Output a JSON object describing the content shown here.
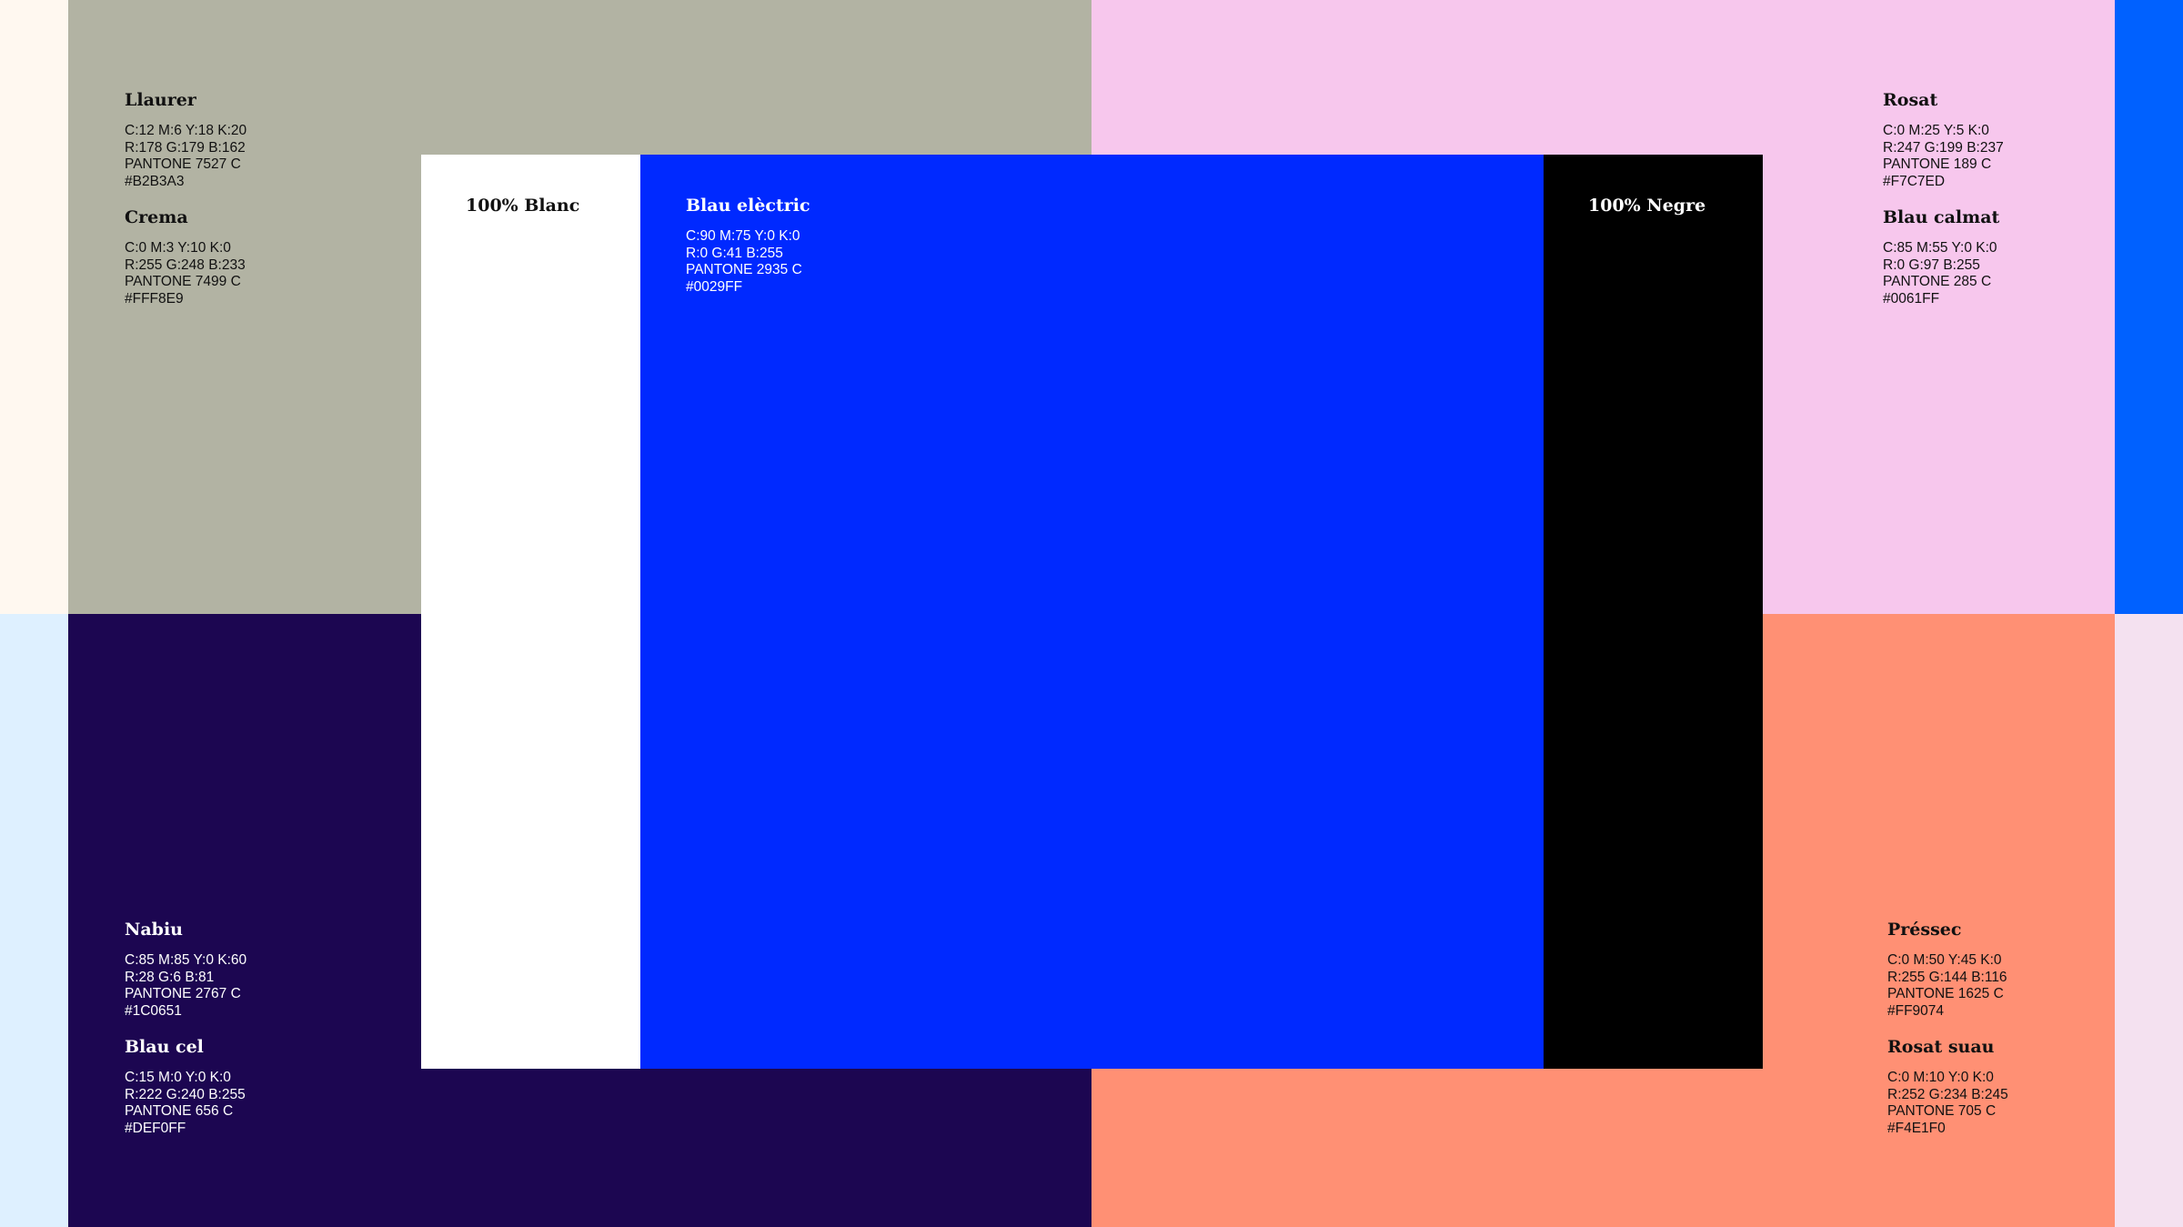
{
  "swatches": {
    "crema_edge": {
      "hex": "#FFF8E9"
    },
    "llaurer": {
      "name": "Llaurer",
      "cmyk": "C:12 M:6 Y:18 K:20",
      "rgb": "R:178 G:179 B:162",
      "pantone": "PANTONE 7527 C",
      "hex": "#B2B3A3"
    },
    "crema": {
      "name": "Crema",
      "cmyk": "C:0 M:3 Y:10 K:0",
      "rgb": "R:255 G:248 B:233",
      "pantone": "PANTONE 7499 C",
      "hex": "#FFF8E9"
    },
    "rosat": {
      "name": "Rosat",
      "cmyk": "C:0 M:25 Y:5 K:0",
      "rgb": "R:247 G:199 B:237",
      "pantone": "PANTONE 189 C",
      "hex": "#F7C7ED"
    },
    "blau_calmat": {
      "name": "Blau calmat",
      "cmyk": "C:85 M:55 Y:0 K:0",
      "rgb": "R:0 G:97 B:255",
      "pantone": "PANTONE 285 C",
      "hex": "#0061FF"
    },
    "nabiu": {
      "name": "Nabiu",
      "cmyk": "C:85 M:85 Y:0 K:60",
      "rgb": "R:28 G:6 B:81",
      "pantone": "PANTONE 2767 C",
      "hex": "#1C0651"
    },
    "blau_cel": {
      "name": "Blau cel",
      "cmyk": "C:15 M:0 Y:0 K:0",
      "rgb": "R:222 G:240 B:255",
      "pantone": "PANTONE 656 C",
      "hex": "#DEF0FF"
    },
    "pressec": {
      "name": "Préssec",
      "cmyk": "C:0 M:50 Y:45 K:0",
      "rgb": "R:255 G:144 B:116",
      "pantone": "PANTONE 1625 C",
      "hex": "#FF9074"
    },
    "rosat_suau": {
      "name": "Rosat suau",
      "cmyk": "C:0 M:10 Y:0 K:0",
      "rgb": "R:252 G:234 B:245",
      "pantone": "PANTONE 705 C",
      "hex": "#F4E1F0"
    },
    "blanc": {
      "name": "100% Blanc",
      "hex": "#FFFFFF"
    },
    "blau_electric": {
      "name": "Blau elèctric",
      "cmyk": "C:90 M:75 Y:0 K:0",
      "rgb": "R:0 G:41 B:255",
      "pantone": "PANTONE 2935 C",
      "hex": "#0029FF"
    },
    "negre": {
      "name": "100% Negre",
      "hex": "#000000"
    }
  }
}
